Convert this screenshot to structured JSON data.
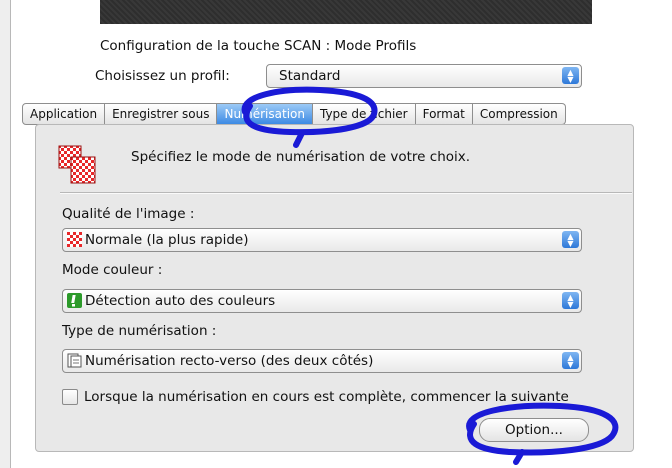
{
  "header": {
    "title": "Configuration de la touche SCAN : Mode Profils",
    "profile_label": "Choisissez un profil:",
    "profile_value": "Standard"
  },
  "tabs": [
    {
      "label": "Application",
      "active": false
    },
    {
      "label": "Enregistrer sous",
      "active": false
    },
    {
      "label": "Numérisation",
      "active": true
    },
    {
      "label": "Type de fichier",
      "active": false
    },
    {
      "label": "Format",
      "active": false
    },
    {
      "label": "Compression",
      "active": false
    }
  ],
  "panel": {
    "description": "Spécifiez le mode de numérisation de votre choix.",
    "image_quality": {
      "label": "Qualité de l'image :",
      "value": "Normale (la plus rapide)",
      "icon": "checker-red-icon"
    },
    "color_mode": {
      "label": "Mode couleur :",
      "value": "Détection auto des couleurs",
      "icon": "green-exclamation-icon"
    },
    "scan_type": {
      "label": "Type de numérisation :",
      "value": "Numérisation recto-verso (des deux côtés)",
      "icon": "duplex-page-icon"
    },
    "checkbox": {
      "label": "Lorsque la numérisation en cours est complète, commencer la suivante",
      "checked": false
    },
    "option_button": "Option..."
  },
  "colors": {
    "accent": "#2e78d8",
    "annotation": "#1a1ad6",
    "panel_bg": "#e8e8e8"
  }
}
